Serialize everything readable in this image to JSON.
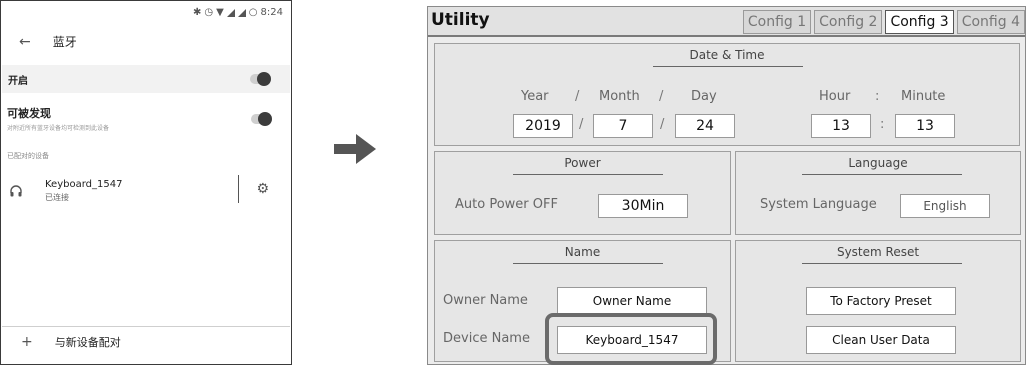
{
  "phone": {
    "status_time": "8:24",
    "title": "蓝牙",
    "enable_label": "开启",
    "discoverable_label": "可被发现",
    "discoverable_subtitle": "对附近所有蓝牙设备均可检测到此设备",
    "paired_section_label": "已配对的设备",
    "device_name": "Keyboard_1547",
    "device_status": "已连接",
    "pair_new_label": "与新设备配对"
  },
  "utility": {
    "title": "Utility",
    "tabs": [
      "Config 1",
      "Config 2",
      "Config 3",
      "Config 4"
    ],
    "active_tab": "Config 3",
    "date_time": {
      "heading": "Date & Time",
      "year_label": "Year",
      "month_label": "Month",
      "day_label": "Day",
      "hour_label": "Hour",
      "minute_label": "Minute",
      "year": "2019",
      "month": "7",
      "day": "24",
      "hour": "13",
      "minute": "13",
      "date_sep": "/",
      "time_sep": ":"
    },
    "power": {
      "heading": "Power",
      "auto_power_label": "Auto Power OFF",
      "auto_power_value": "30Min"
    },
    "language": {
      "heading": "Language",
      "system_language_label": "System Language",
      "system_language_value": "English"
    },
    "name": {
      "heading": "Name",
      "owner_label": "Owner Name",
      "owner_value": "Owner Name",
      "device_label": "Device Name",
      "device_value": "Keyboard_1547"
    },
    "reset": {
      "heading": "System Reset",
      "factory_button": "To Factory Preset",
      "clean_button": "Clean User Data"
    }
  },
  "colors": {
    "panel_bg": "#ececec",
    "highlight": "#6b6b6b",
    "arrow": "#555555"
  },
  "icons": [
    "bluetooth-icon",
    "alarm-icon",
    "wifi-icon",
    "signal-icon",
    "battery-icon",
    "back-arrow-icon",
    "headphone-icon",
    "gear-icon",
    "plus-icon",
    "right-arrow-icon"
  ]
}
